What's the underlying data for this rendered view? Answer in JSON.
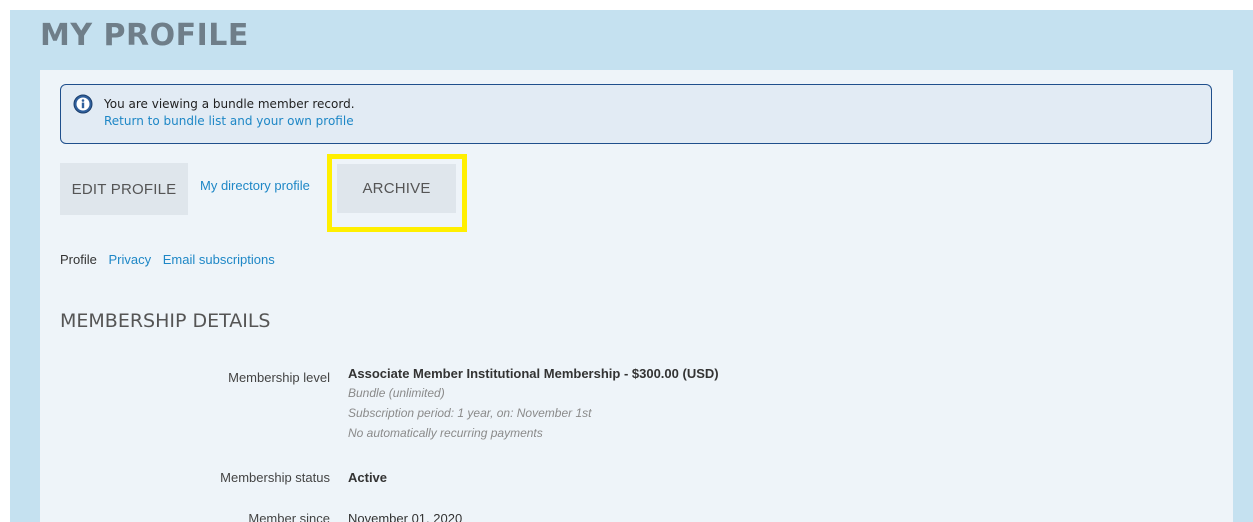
{
  "page": {
    "title": "MY PROFILE"
  },
  "notice": {
    "icon": "info-icon",
    "text": "You are viewing a bundle member record.",
    "link": "Return to bundle list and your own profile",
    "border_color": "#1f4f8c"
  },
  "actions": {
    "edit_profile": "EDIT PROFILE",
    "directory_profile": "My directory profile",
    "archive": "ARCHIVE",
    "highlight_color": "#ffef00"
  },
  "subnav": {
    "items": [
      {
        "label": "Profile",
        "active": true
      },
      {
        "label": "Privacy",
        "active": false
      },
      {
        "label": "Email subscriptions",
        "active": false
      }
    ]
  },
  "membership": {
    "heading": "MEMBERSHIP DETAILS",
    "level_label": "Membership level",
    "level_value": "Associate Member Institutional Membership - $300.00 (USD)",
    "level_details": [
      "Bundle (unlimited)",
      "Subscription period: 1 year, on: November 1st",
      "No automatically recurring payments"
    ],
    "status_label": "Membership status",
    "status_value": "Active",
    "since_label": "Member since",
    "since_value": "November 01, 2020"
  },
  "colors": {
    "frame_bg": "#c5e1f0",
    "content_bg": "#eef4f9",
    "link": "#1e87c6",
    "button_bg": "#dfe6ec"
  }
}
